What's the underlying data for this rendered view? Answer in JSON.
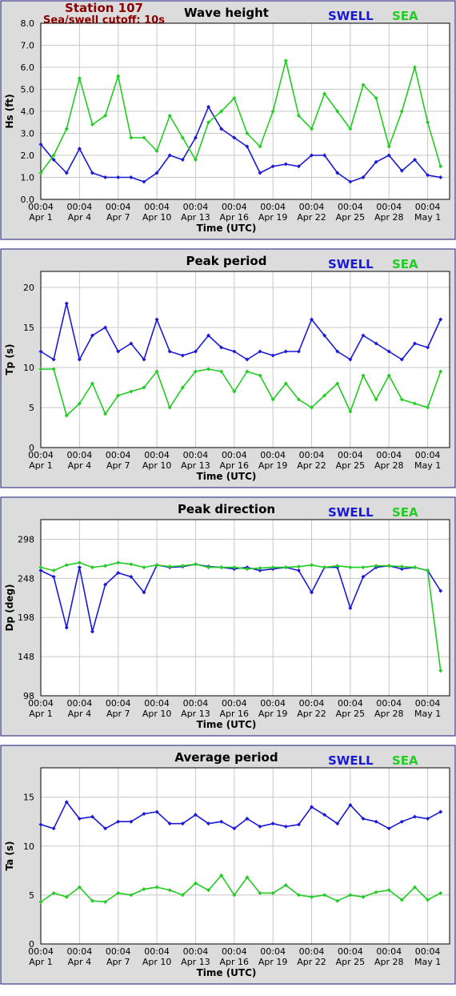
{
  "header": {
    "station": "Station 107",
    "cutoff": "Sea/swell cutoff: 10s"
  },
  "colors": {
    "swell": "#1a1ad6",
    "sea": "#22cc22",
    "panel_bg": "#dcdcdc",
    "panel_border": "#1a1a7a",
    "grid": "#c8c8c8",
    "header_text": "#8b0000"
  },
  "legend": {
    "swell": "SWELL",
    "sea": "SEA"
  },
  "x_axis": {
    "title": "Time (UTC)",
    "tick_days": [
      0,
      3,
      6,
      9,
      12,
      15,
      18,
      21,
      24,
      27,
      30
    ],
    "tick_time": [
      "00:04",
      "00:04",
      "00:04",
      "00:04",
      "00:04",
      "00:04",
      "00:04",
      "00:04",
      "00:04",
      "00:04",
      "00:04"
    ],
    "tick_date": [
      "Apr 1",
      "Apr 4",
      "Apr 7",
      "Apr 10",
      "Apr 13",
      "Apr 16",
      "Apr 19",
      "Apr 22",
      "Apr 25",
      "Apr 28",
      "May 1"
    ]
  },
  "chart_data": [
    {
      "type": "line",
      "title": "Wave height",
      "ylabel": "Hs (ft)",
      "xlabel": "Time (UTC)",
      "ylim": [
        0,
        8
      ],
      "yticks": [
        0,
        1,
        2,
        3,
        4,
        5,
        6,
        7,
        8
      ],
      "ytick_labels": [
        "0.0",
        "1.0",
        "2.0",
        "3.0",
        "4.0",
        "5.0",
        "6.0",
        "7.0",
        "8.0"
      ],
      "grid": true,
      "legend_position": "top-right",
      "x": [
        "Apr 1",
        "Apr 2",
        "Apr 3",
        "Apr 4",
        "Apr 5",
        "Apr 6",
        "Apr 7",
        "Apr 8",
        "Apr 9",
        "Apr 10",
        "Apr 11",
        "Apr 12",
        "Apr 13",
        "Apr 14",
        "Apr 15",
        "Apr 16",
        "Apr 17",
        "Apr 18",
        "Apr 19",
        "Apr 20",
        "Apr 21",
        "Apr 22",
        "Apr 23",
        "Apr 24",
        "Apr 25",
        "Apr 26",
        "Apr 27",
        "Apr 28",
        "Apr 29",
        "Apr 30",
        "May 1",
        "May 2"
      ],
      "series": [
        {
          "name": "SWELL",
          "values": [
            2.5,
            1.8,
            1.2,
            2.3,
            1.2,
            1.0,
            1.0,
            1.0,
            0.8,
            1.2,
            2.0,
            1.8,
            2.8,
            4.2,
            3.2,
            2.8,
            2.4,
            1.2,
            1.5,
            1.6,
            1.5,
            2.0,
            2.0,
            1.2,
            0.8,
            1.0,
            1.7,
            2.0,
            1.3,
            1.8,
            1.1,
            1.0
          ]
        },
        {
          "name": "SEA",
          "values": [
            1.2,
            2.0,
            3.2,
            5.5,
            3.4,
            3.8,
            5.6,
            2.8,
            2.8,
            2.2,
            3.8,
            2.8,
            1.8,
            3.5,
            4.0,
            4.6,
            3.0,
            2.4,
            4.0,
            6.3,
            3.8,
            3.2,
            4.8,
            4.0,
            3.2,
            5.2,
            4.6,
            2.4,
            4.0,
            6.0,
            3.5,
            1.5
          ]
        }
      ]
    },
    {
      "type": "line",
      "title": "Peak period",
      "ylabel": "Tp (s)",
      "xlabel": "Time (UTC)",
      "ylim": [
        0,
        22
      ],
      "yticks": [
        0,
        5,
        10,
        15,
        20
      ],
      "ytick_labels": [
        "0",
        "5",
        "10",
        "15",
        "20"
      ],
      "grid": true,
      "legend_position": "top-right",
      "x": [
        "Apr 1",
        "Apr 2",
        "Apr 3",
        "Apr 4",
        "Apr 5",
        "Apr 6",
        "Apr 7",
        "Apr 8",
        "Apr 9",
        "Apr 10",
        "Apr 11",
        "Apr 12",
        "Apr 13",
        "Apr 14",
        "Apr 15",
        "Apr 16",
        "Apr 17",
        "Apr 18",
        "Apr 19",
        "Apr 20",
        "Apr 21",
        "Apr 22",
        "Apr 23",
        "Apr 24",
        "Apr 25",
        "Apr 26",
        "Apr 27",
        "Apr 28",
        "Apr 29",
        "Apr 30",
        "May 1",
        "May 2"
      ],
      "series": [
        {
          "name": "SWELL",
          "values": [
            12.0,
            11.0,
            18.0,
            11.0,
            14.0,
            15.0,
            12.0,
            13.0,
            11.0,
            16.0,
            12.0,
            11.5,
            12.0,
            14.0,
            12.5,
            12.0,
            11.0,
            12.0,
            11.5,
            12.0,
            12.0,
            16.0,
            14.0,
            12.0,
            11.0,
            14.0,
            13.0,
            12.0,
            11.0,
            13.0,
            12.5,
            16.0
          ]
        },
        {
          "name": "SEA",
          "values": [
            9.8,
            9.8,
            4.0,
            5.5,
            8.0,
            4.2,
            6.5,
            7.0,
            7.5,
            9.5,
            5.0,
            7.5,
            9.5,
            9.8,
            9.5,
            7.0,
            9.5,
            9.0,
            6.0,
            8.0,
            6.0,
            5.0,
            6.5,
            8.0,
            4.5,
            9.0,
            6.0,
            9.0,
            6.0,
            5.5,
            5.0,
            9.5
          ]
        }
      ]
    },
    {
      "type": "line",
      "title": "Peak direction",
      "ylabel": "Dp (deg)",
      "xlabel": "Time (UTC)",
      "ylim": [
        98,
        323
      ],
      "yticks": [
        98,
        148,
        198,
        248,
        298
      ],
      "ytick_labels": [
        "98",
        "148",
        "198",
        "248",
        "298"
      ],
      "grid": true,
      "legend_position": "top-right",
      "x": [
        "Apr 1",
        "Apr 2",
        "Apr 3",
        "Apr 4",
        "Apr 5",
        "Apr 6",
        "Apr 7",
        "Apr 8",
        "Apr 9",
        "Apr 10",
        "Apr 11",
        "Apr 12",
        "Apr 13",
        "Apr 14",
        "Apr 15",
        "Apr 16",
        "Apr 17",
        "Apr 18",
        "Apr 19",
        "Apr 20",
        "Apr 21",
        "Apr 22",
        "Apr 23",
        "Apr 24",
        "Apr 25",
        "Apr 26",
        "Apr 27",
        "Apr 28",
        "Apr 29",
        "Apr 30",
        "May 1",
        "May 2"
      ],
      "series": [
        {
          "name": "SWELL",
          "values": [
            258,
            250,
            185,
            262,
            180,
            240,
            255,
            250,
            230,
            265,
            262,
            263,
            266,
            263,
            262,
            260,
            262,
            258,
            260,
            262,
            258,
            230,
            262,
            262,
            210,
            250,
            262,
            264,
            260,
            262,
            258,
            232
          ]
        },
        {
          "name": "SEA",
          "values": [
            262,
            258,
            265,
            268,
            262,
            264,
            268,
            266,
            262,
            265,
            263,
            264,
            266,
            262,
            262,
            262,
            260,
            261,
            262,
            262,
            263,
            265,
            262,
            264,
            262,
            262,
            264,
            264,
            263,
            262,
            258,
            130
          ]
        }
      ]
    },
    {
      "type": "line",
      "title": "Average period",
      "ylabel": "Ta (s)",
      "xlabel": "Time (UTC)",
      "ylim": [
        0,
        18
      ],
      "yticks": [
        0,
        5,
        10,
        15
      ],
      "ytick_labels": [
        "0",
        "5",
        "10",
        "15"
      ],
      "grid": true,
      "legend_position": "top-right",
      "x": [
        "Apr 1",
        "Apr 2",
        "Apr 3",
        "Apr 4",
        "Apr 5",
        "Apr 6",
        "Apr 7",
        "Apr 8",
        "Apr 9",
        "Apr 10",
        "Apr 11",
        "Apr 12",
        "Apr 13",
        "Apr 14",
        "Apr 15",
        "Apr 16",
        "Apr 17",
        "Apr 18",
        "Apr 19",
        "Apr 20",
        "Apr 21",
        "Apr 22",
        "Apr 23",
        "Apr 24",
        "Apr 25",
        "Apr 26",
        "Apr 27",
        "Apr 28",
        "Apr 29",
        "Apr 30",
        "May 1",
        "May 2"
      ],
      "series": [
        {
          "name": "SWELL",
          "values": [
            12.2,
            11.8,
            14.5,
            12.8,
            13.0,
            11.8,
            12.5,
            12.5,
            13.3,
            13.5,
            12.3,
            12.3,
            13.2,
            12.3,
            12.5,
            11.8,
            12.8,
            12.0,
            12.3,
            12.0,
            12.2,
            14.0,
            13.2,
            12.3,
            14.2,
            12.8,
            12.5,
            11.8,
            12.5,
            13.0,
            12.8,
            13.5
          ]
        },
        {
          "name": "SEA",
          "values": [
            4.3,
            5.2,
            4.8,
            5.8,
            4.4,
            4.3,
            5.2,
            5.0,
            5.6,
            5.8,
            5.5,
            5.0,
            6.2,
            5.5,
            7.0,
            5.0,
            6.8,
            5.2,
            5.2,
            6.0,
            5.0,
            4.8,
            5.0,
            4.4,
            5.0,
            4.8,
            5.3,
            5.5,
            4.5,
            5.8,
            4.5,
            5.2
          ]
        }
      ]
    }
  ]
}
